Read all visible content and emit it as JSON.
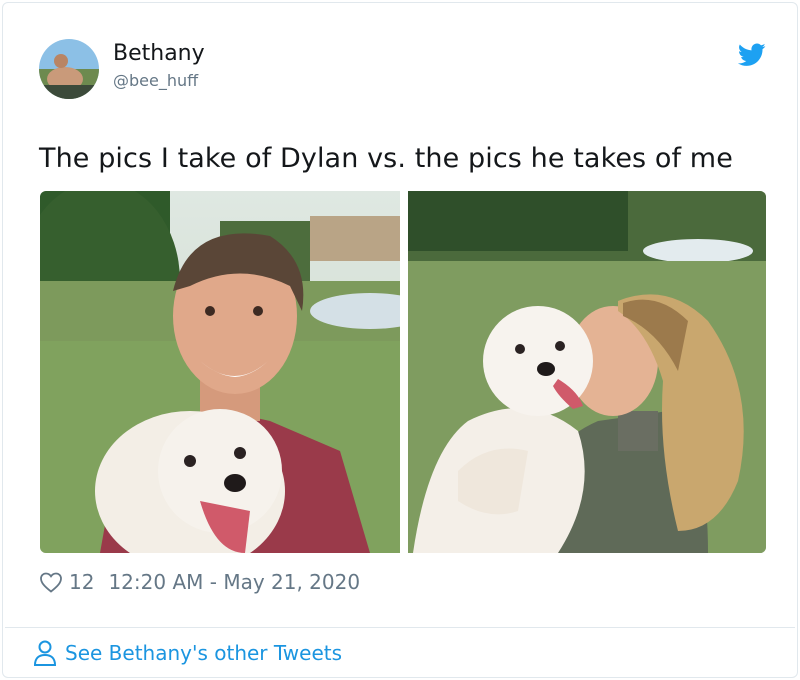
{
  "author": {
    "name": "Bethany",
    "handle": "@bee_huff"
  },
  "tweet": {
    "text": "The pics I take of Dylan vs. the pics he takes of me",
    "like_count": "12",
    "timestamp": "12:20 AM - May 21, 2020"
  },
  "footer": {
    "more_link": "See Bethany's other Tweets"
  },
  "icons": {
    "brand": "twitter-bird-icon",
    "like": "heart-icon",
    "profile": "person-icon"
  },
  "colors": {
    "twitter_blue": "#1da1f2",
    "link_blue": "#1b95e0",
    "secondary_text": "#657786"
  }
}
